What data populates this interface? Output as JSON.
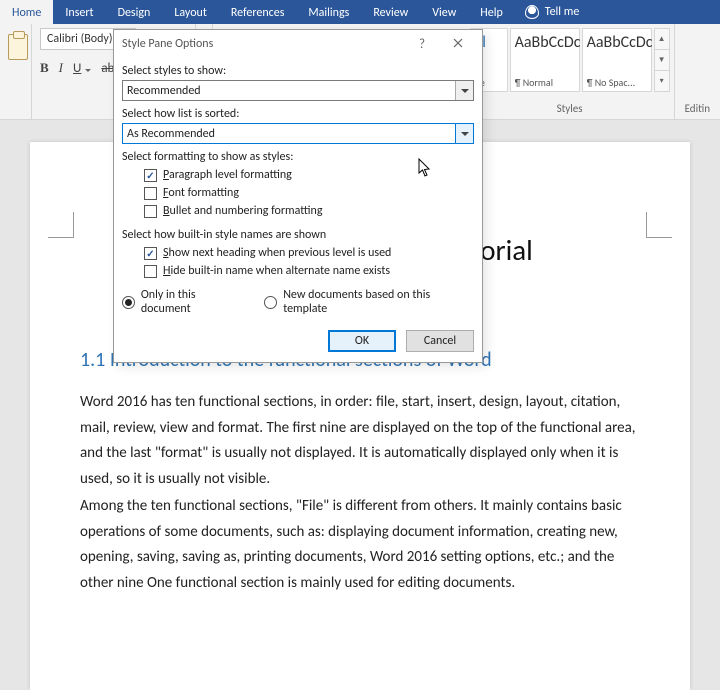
{
  "tabs": {
    "home": "Home",
    "insert": "Insert",
    "design": "Design",
    "layout": "Layout",
    "references": "References",
    "mailings": "Mailings",
    "review": "Review",
    "view": "View",
    "help": "Help",
    "tell_me": "Tell me"
  },
  "ribbon": {
    "font_name": "Calibri (Body)",
    "bold": "B",
    "italic": "I",
    "underline": "U",
    "strike": "abc",
    "style_tiles": [
      {
        "preview": "al",
        "name": "ne",
        "blue": true
      },
      {
        "preview": "AaBbCcDc",
        "name": "¶ Normal",
        "blue": false
      },
      {
        "preview": "AaBbCcDc",
        "name": "¶ No Spac...",
        "blue": false
      }
    ],
    "styles_label": "Styles",
    "editing_label": "Editin"
  },
  "dialog": {
    "title": "Style Pane Options",
    "lbl_select_styles": "Select styles to show:",
    "val_select_styles": "Recommended",
    "lbl_sort": "Select how list is sorted:",
    "val_sort": "As Recommended",
    "lbl_formatting": "Select formatting to show as styles:",
    "chk_paragraph": "aragraph level formatting",
    "chk_font": "ont formatting",
    "chk_bullet": "ullet and numbering formatting",
    "lbl_builtin": "Select how built-in style names are shown",
    "chk_next_heading": "how next heading when previous level is used",
    "chk_hide_builtin": "ide built-in name when alternate name exists",
    "radio_only": "Only in this document",
    "radio_new": "New documents based on this template",
    "ok": "OK",
    "cancel": "Cancel"
  },
  "document": {
    "title": "Word basic operation tutorial",
    "h1": "1.1 Introduction to the functional sections of Word",
    "p1": "Word 2016 has ten functional sections, in order: file, start, insert, design, layout, citation, mail, review, view and format. The first nine are displayed on the top of the functional area, and the last \"format\" is usually not displayed. It is automatically displayed only when it is used, so it is usually not visible.",
    "p2": "Among the ten functional sections, \"File\" is different from others. It mainly contains basic operations of some documents, such as: displaying document information, creating new, opening, saving, saving as, printing documents, Word 2016 setting options, etc.; and the other nine One functional section is mainly used for editing documents."
  }
}
